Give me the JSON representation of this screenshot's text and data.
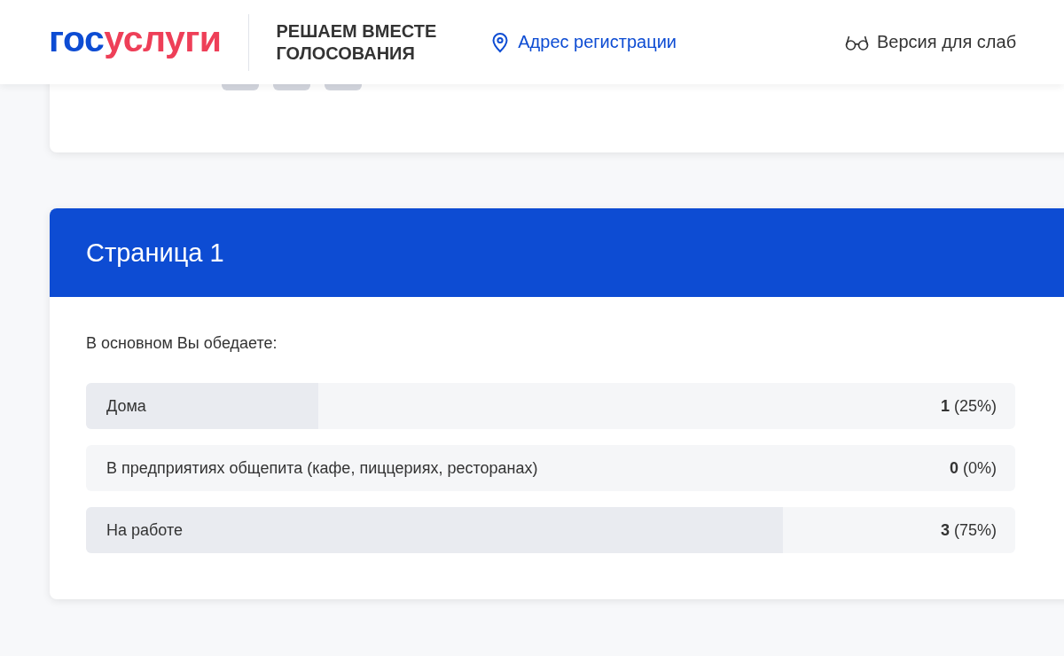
{
  "header": {
    "logo": {
      "part_1": "гос",
      "part_2": "услуги"
    },
    "title_line_1": "РЕШАЕМ ВМЕСТЕ",
    "title_line_2": "ГОЛОСОВАНИЯ",
    "address_link": "Адрес регистрации",
    "accessibility_link": "Версия для слаб"
  },
  "page": {
    "title": "Страница 1",
    "question": "В основном Вы обедаете:",
    "answers": [
      {
        "label": "Дома",
        "result": "**1** (25%)",
        "level": 0.25
      },
      {
        "label": "В предприятиях общепита (кафе, пиццериях, ресторанах)",
        "result": "**0** (0%)",
        "level": 0
      },
      {
        "label": "На работе",
        "result": "**3** (75%)",
        "level": 0.75
      }
    ]
  }
}
